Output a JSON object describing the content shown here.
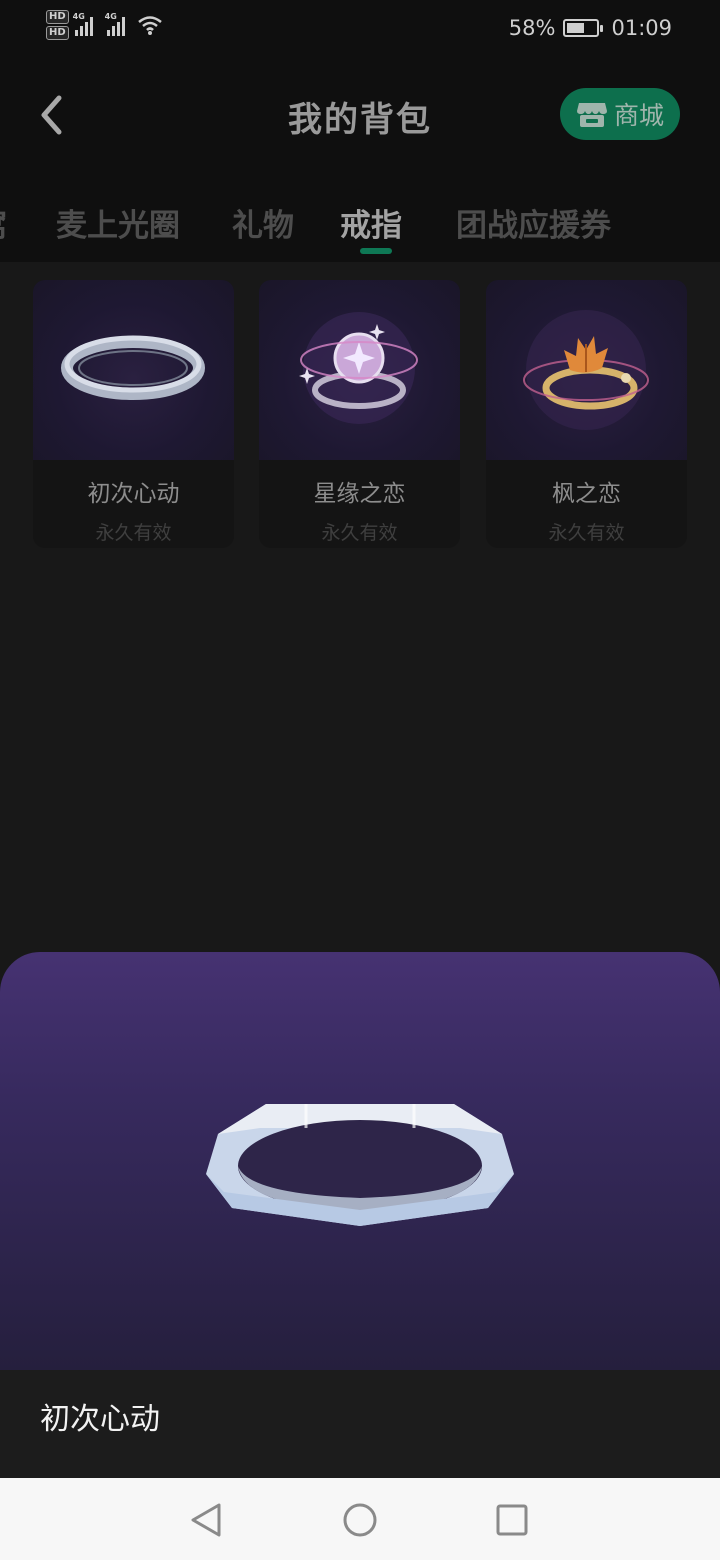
{
  "status_bar": {
    "hd1": "HD",
    "hd2": "HD",
    "net1": "4G",
    "net2": "4G",
    "battery_percent": "58%",
    "battery_level": 0.58,
    "time": "01:09"
  },
  "header": {
    "title": "我的背包",
    "mall_label": "商城",
    "back_icon": "chevron-left-icon",
    "mall_icon": "store-icon"
  },
  "tabs": [
    {
      "label": "窝"
    },
    {
      "label": "麦上光圈"
    },
    {
      "label": "礼物"
    },
    {
      "label": "戒指",
      "active": true
    },
    {
      "label": "团战应援券"
    }
  ],
  "items": [
    {
      "name": "初次心动",
      "validity": "永久有效"
    },
    {
      "name": "星缘之恋",
      "validity": "永久有效"
    },
    {
      "name": "枫之恋",
      "validity": "永久有效"
    }
  ],
  "preview": {
    "name": "初次心动"
  },
  "colors": {
    "accent": "#0d6f4d",
    "tab_underline": "#0e7855",
    "sheet_top": "#463272",
    "sheet_bottom": "#251f3d"
  }
}
